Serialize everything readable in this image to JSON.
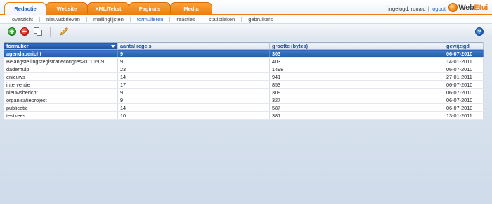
{
  "tabs": [
    {
      "label": "Redactie",
      "active": true
    },
    {
      "label": "Website",
      "active": false
    },
    {
      "label": "XML/Tekst",
      "active": false
    },
    {
      "label": "Pagina's",
      "active": false
    },
    {
      "label": "Media",
      "active": false
    }
  ],
  "session": {
    "logged_in_text": "ingelogd: ronald",
    "separator": "|",
    "logout_label": "logout"
  },
  "logo": {
    "part1": "Web",
    "part2": "Etui"
  },
  "subnav": [
    {
      "label": "overzicht",
      "active": false
    },
    {
      "label": "nieuwsbrieven",
      "active": false
    },
    {
      "label": "mailinglijsten",
      "active": false
    },
    {
      "label": "formulieren",
      "active": true
    },
    {
      "label": "reacties",
      "active": false
    },
    {
      "label": "statistieken",
      "active": false
    },
    {
      "label": "gebruikers",
      "active": false
    }
  ],
  "toolbar": {
    "add_icon": "plus-circle-icon",
    "delete_icon": "minus-circle-icon",
    "copy_icon": "copy-icon",
    "edit_icon": "pencil-icon",
    "help_label": "?"
  },
  "grid": {
    "columns": [
      "formulier",
      "aantal regels",
      "grootte (bytes)",
      "gewijzigd"
    ],
    "sorted_column": 0,
    "rows": [
      {
        "name": "agendabericht",
        "regels": "9",
        "grootte": "303",
        "gewijzigd": "06-07-2010",
        "selected": true
      },
      {
        "name": "Belangstellingsregistratiecongres20110509",
        "regels": "9",
        "grootte": "403",
        "gewijzigd": "14-01-2011",
        "selected": false
      },
      {
        "name": "daderhulp",
        "regels": "23",
        "grootte": "1498",
        "gewijzigd": "06-07-2010",
        "selected": false
      },
      {
        "name": "enieuws",
        "regels": "14",
        "grootte": "941",
        "gewijzigd": "27-01-2011",
        "selected": false
      },
      {
        "name": "interventie",
        "regels": "17",
        "grootte": "853",
        "gewijzigd": "06-07-2010",
        "selected": false
      },
      {
        "name": "nieuwsbericht",
        "regels": "9",
        "grootte": "309",
        "gewijzigd": "06-07-2010",
        "selected": false
      },
      {
        "name": "organisatieproject",
        "regels": "9",
        "grootte": "327",
        "gewijzigd": "06-07-2010",
        "selected": false
      },
      {
        "name": "publicatie",
        "regels": "14",
        "grootte": "587",
        "gewijzigd": "06-07-2010",
        "selected": false
      },
      {
        "name": "testkees",
        "regels": "10",
        "grootte": "381",
        "gewijzigd": "13-01-2011",
        "selected": false
      }
    ]
  },
  "colors": {
    "accent_orange": "#f07c0a",
    "link_blue": "#1a63b8",
    "selected_row": "#2c64b4"
  }
}
